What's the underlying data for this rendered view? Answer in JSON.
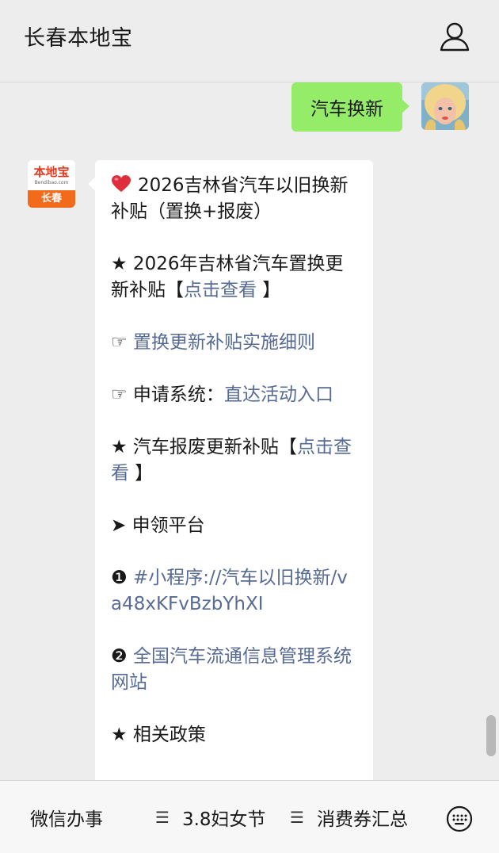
{
  "header": {
    "title": "长春本地宝",
    "profile_icon": "user-profile-icon"
  },
  "chat": {
    "user_message": "汽车换新",
    "bot_avatar": {
      "logo_text": "本地宝",
      "logo_url": "Bendibao.com",
      "city": "长春"
    },
    "bot_message": {
      "title": "2026吉林省汽车以旧换新补贴（置换+报废）",
      "line2_prefix": "★ 2026年吉林省汽车置换更新补贴【",
      "line2_link": "点击查看",
      "line2_suffix": " 】",
      "line3_prefix": "☞ ",
      "line3_link": "置换更新补贴实施细则",
      "line4_prefix": "☞ 申请系统：",
      "line4_link": "直达活动入口",
      "line5_prefix": "★ 汽车报废更新补贴【",
      "line5_link": "点击查看",
      "line5_suffix": " 】",
      "line6": "➤ 申领平台",
      "line7_prefix": "❶ ",
      "line7_link": "#小程序://汽车以旧换新/va48xKFvBzbYhXI",
      "line8_prefix": "❷ ",
      "line8_link": "全国汽车流通信息管理系统网站",
      "line9": "★ 相关政策"
    }
  },
  "bottom_menu": {
    "items": [
      {
        "label": "微信办事"
      },
      {
        "label": "3.8妇女节"
      },
      {
        "label": "消费券汇总"
      }
    ],
    "menu_glyph": "☰",
    "keyboard_icon": "keyboard-icon"
  },
  "colors": {
    "user_bubble": "#95ec69",
    "link": "#576b95",
    "background": "#ededed"
  }
}
